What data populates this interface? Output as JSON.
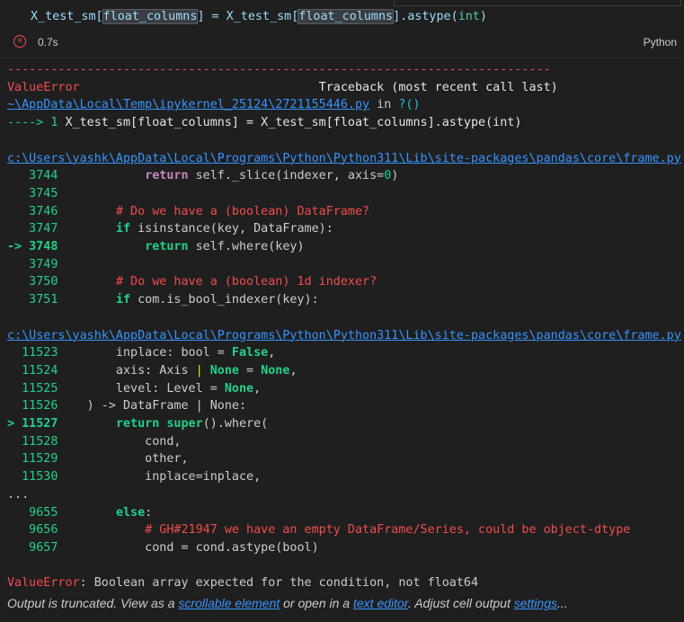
{
  "cell": {
    "code_prefix": "X_test_sm[",
    "code_sel1": "float_columns",
    "code_mid": "] = X_test_sm[",
    "code_sel2": "float_columns",
    "code_suffix": "].astype(",
    "code_arg": "int",
    "code_end": ")",
    "time": "0.7s",
    "language": "Python"
  },
  "traceback": {
    "dashes": "---------------------------------------------------------------------------",
    "error_name": "ValueError",
    "traceback_label": "Traceback (most recent call last)",
    "file1": "~\\AppData\\Local\\Temp\\ipykernel_25124\\2721155446.py",
    "in_text": " in ",
    "file1_func": "?()",
    "arrow1": "----> 1 ",
    "arrow1_code": "X_test_sm[float_columns] = X_test_sm[float_columns].astype(int)",
    "file2": "c:\\Users\\yashk\\AppData\\Local\\Programs\\Python\\Python311\\Lib\\site-packages\\pandas\\core\\frame.py",
    "file3": "c:\\Users\\yashk\\AppData\\Local\\Programs\\Python\\Python311\\Lib\\site-packages\\pandas\\core\\frame.py",
    "ellipsis": "...",
    "final_error_name": "ValueError",
    "final_error_msg": ": Boolean array expected for the condition, not float64"
  },
  "footer": {
    "t1": "Output is truncated. View as a ",
    "l1": "scrollable element",
    "t2": " or open in a ",
    "l2": "text editor",
    "t3": ". Adjust cell output ",
    "l3": "settings",
    "t4": "..."
  }
}
